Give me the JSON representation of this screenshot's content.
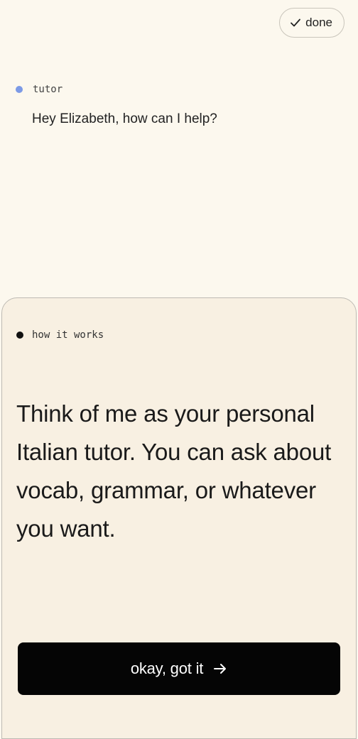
{
  "header": {
    "done_label": "done",
    "done_icon": "check-icon"
  },
  "conversation": {
    "speaker": "tutor",
    "speaker_color": "#7c9ae6",
    "message": "Hey Elizabeth, how can I help?"
  },
  "sheet": {
    "title": "how it works",
    "body": "Think of me as your personal Italian tutor. You can ask about vocab, grammar, or whatever you want.",
    "cta_label": "okay, got it",
    "cta_icon": "arrow-right-icon"
  },
  "colors": {
    "background": "#fcf8ee",
    "sheet_background": "#f8f0e2",
    "cta_background": "#050505"
  }
}
